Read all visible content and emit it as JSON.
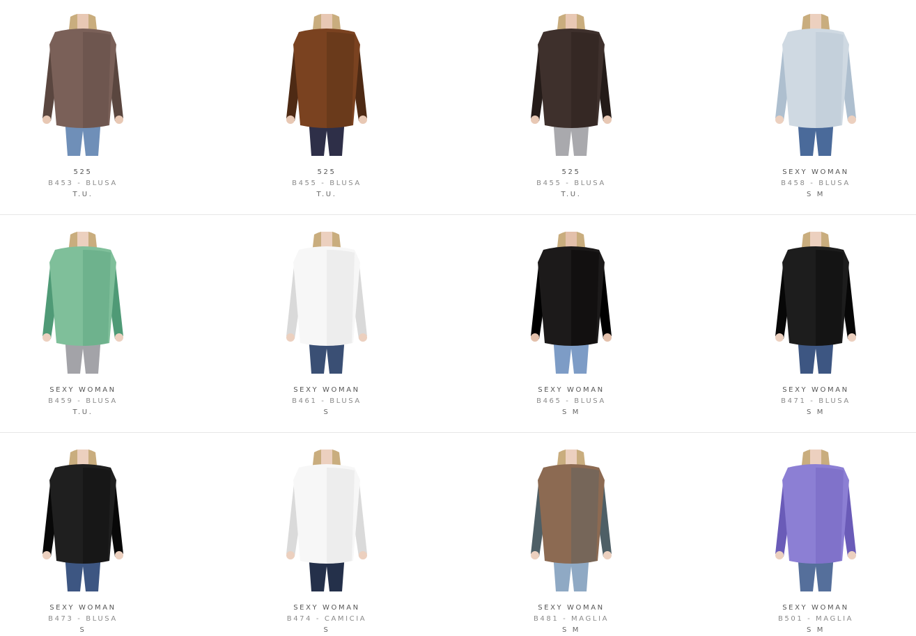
{
  "products": [
    {
      "brand": "525",
      "model": "B453 - BLUSA",
      "sizes": "T.U.",
      "shirt": "#7a6058",
      "shirt_dark": "#5a463f",
      "legs": "#6f8fb8",
      "skin": "#e8c8b4"
    },
    {
      "brand": "525",
      "model": "B455 - BLUSA",
      "sizes": "T.U.",
      "shirt": "#7a4220",
      "shirt_dark": "#4e2a14",
      "legs": "#2e2f48",
      "skin": "#e8c8b4"
    },
    {
      "brand": "525",
      "model": "B455 - BLUSA",
      "sizes": "T.U.",
      "shirt": "#3e302c",
      "shirt_dark": "#241b18",
      "legs": "#a9a9ad",
      "skin": "#e8c8b4"
    },
    {
      "brand": "SEXY WOMAN",
      "model": "B458 - BLUSA",
      "sizes": "S M",
      "shirt": "#cfd9e2",
      "shirt_dark": "#aebfcf",
      "legs": "#4a6a9a",
      "skin": "#ecd0bf"
    },
    {
      "brand": "SEXY WOMAN",
      "model": "B459 - BLUSA",
      "sizes": "T.U.",
      "shirt": "#7fbf9a",
      "shirt_dark": "#4f9a76",
      "legs": "#a3a3a8",
      "skin": "#ecd0bf"
    },
    {
      "brand": "SEXY WOMAN",
      "model": "B461 - BLUSA",
      "sizes": "S",
      "shirt": "#f7f7f7",
      "shirt_dark": "#d9d9d9",
      "legs": "#3a4f74",
      "skin": "#ecd0bf"
    },
    {
      "brand": "SEXY WOMAN",
      "model": "B465 - BLUSA",
      "sizes": "S M",
      "shirt": "#1c1a1a",
      "shirt_dark": "#000000",
      "legs": "#7d9cc6",
      "skin": "#e3c0ab"
    },
    {
      "brand": "SEXY WOMAN",
      "model": "B471 - BLUSA",
      "sizes": "S M",
      "shirt": "#1d1d1d",
      "shirt_dark": "#070707",
      "legs": "#3d5682",
      "skin": "#ecd0bf"
    },
    {
      "brand": "SEXY WOMAN",
      "model": "B473 - BLUSA",
      "sizes": "S",
      "shirt": "#1f1f1f",
      "shirt_dark": "#080808",
      "legs": "#3d5682",
      "skin": "#ecd0bf"
    },
    {
      "brand": "SEXY WOMAN",
      "model": "B474 - CAMICIA",
      "sizes": "S",
      "shirt": "#f7f7f7",
      "shirt_dark": "#dadada",
      "legs": "#24304a",
      "skin": "#ecd0bf"
    },
    {
      "brand": "SEXY WOMAN",
      "model": "B481 - MAGLIA",
      "sizes": "S M",
      "shirt": "#8c6a52",
      "shirt_dark": "#4e5f66",
      "legs": "#8fa9c4",
      "skin": "#ecd0bf"
    },
    {
      "brand": "SEXY WOMAN",
      "model": "B501 - MAGLIA",
      "sizes": "S M",
      "shirt": "#8c7fd4",
      "shirt_dark": "#6a5bb8",
      "legs": "#556f9b",
      "skin": "#ecd0bf"
    }
  ]
}
